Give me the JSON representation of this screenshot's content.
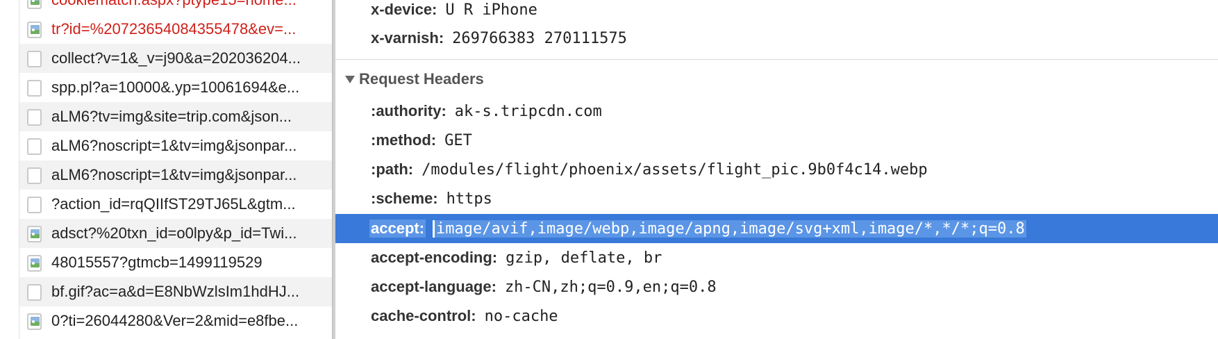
{
  "request_list": {
    "items": [
      {
        "name": "cookiematch.aspx?ptype15=home...",
        "icon": "image-file-icon",
        "error": true
      },
      {
        "name": "tr?id=%20723654084355478&ev=...",
        "icon": "image-file-icon",
        "error": true
      },
      {
        "name": "collect?v=1&_v=j90&a=202036204...",
        "icon": "document-file-icon",
        "error": false
      },
      {
        "name": "spp.pl?a=10000&.yp=10061694&e...",
        "icon": "document-file-icon",
        "error": false
      },
      {
        "name": "aLM6?tv=img&site=trip.com&json...",
        "icon": "document-file-icon",
        "error": false
      },
      {
        "name": "aLM6?noscript=1&tv=img&jsonpar...",
        "icon": "document-file-icon",
        "error": false
      },
      {
        "name": "aLM6?noscript=1&tv=img&jsonpar...",
        "icon": "document-file-icon",
        "error": false
      },
      {
        "name": "?action_id=rqQIIfST29TJ65L&gtm...",
        "icon": "document-file-icon",
        "error": false
      },
      {
        "name": "adsct?%20txn_id=o0lpy&p_id=Twi...",
        "icon": "image-file-icon",
        "error": false
      },
      {
        "name": "48015557?gtmcb=1499119529",
        "icon": "image-file-icon",
        "error": false
      },
      {
        "name": "bf.gif?ac=a&d=E8NbWzlsIm1hdHJ...",
        "icon": "document-file-icon",
        "error": false
      },
      {
        "name": "0?ti=26044280&Ver=2&mid=e8fbe...",
        "icon": "image-file-icon",
        "error": false
      }
    ]
  },
  "response_headers_tail": [
    {
      "key": "x-device:",
      "value": "U R iPhone"
    },
    {
      "key": "x-varnish:",
      "value": "269766383 270111575"
    }
  ],
  "request_headers": {
    "title": "Request Headers",
    "rows": [
      {
        "key": ":authority:",
        "value": "ak-s.tripcdn.com"
      },
      {
        "key": ":method:",
        "value": "GET"
      },
      {
        "key": ":path:",
        "value": "/modules/flight/phoenix/assets/flight_pic.9b0f4c14.webp"
      },
      {
        "key": ":scheme:",
        "value": "https"
      },
      {
        "key": "accept:",
        "value": "image/avif,image/webp,image/apng,image/svg+xml,image/*,*/*;q=0.8"
      },
      {
        "key": "accept-encoding:",
        "value": "gzip, deflate, br"
      },
      {
        "key": "accept-language:",
        "value": "zh-CN,zh;q=0.9,en;q=0.8"
      },
      {
        "key": "cache-control:",
        "value": "no-cache"
      }
    ]
  },
  "colors": {
    "error_text": "#d0201a",
    "selection": "#3879d9"
  }
}
